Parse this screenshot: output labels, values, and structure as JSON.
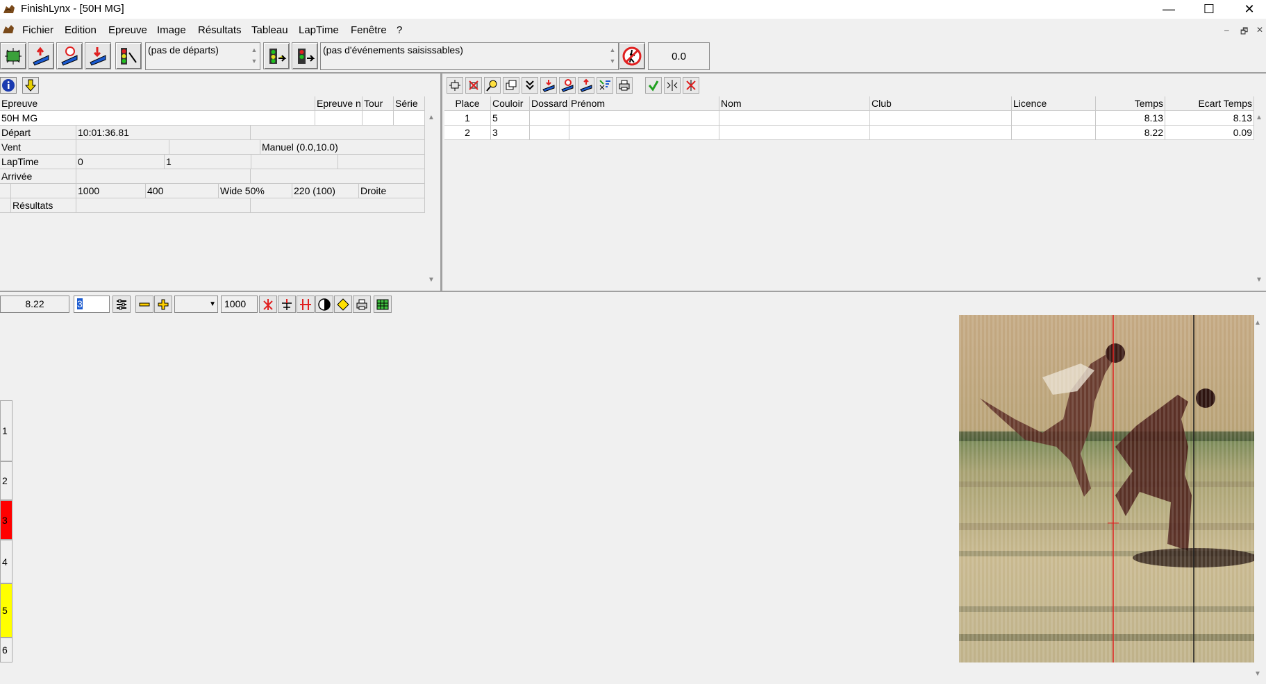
{
  "window": {
    "title": "FinishLynx - [50H MG]",
    "minimize": "—",
    "maximize": "☐",
    "close": "✕"
  },
  "menu": [
    "Fichier",
    "Edition",
    "Epreuve",
    "Image",
    "Résultats",
    "Tableau",
    "LapTime",
    "Fenêtre",
    "?"
  ],
  "mdi": {
    "minimize": "–",
    "restore": "🗗",
    "close": "✕"
  },
  "toolbar": {
    "starts_combo": "(pas de départs)",
    "events_combo": "(pas d'événements saisissables)",
    "running_time": "0.0"
  },
  "event_grid": {
    "headers": {
      "event": "Epreuve",
      "event_num": "Epreuve n",
      "round": "Tour",
      "heat": "Série"
    },
    "event_name": "50H MG",
    "rows": {
      "start": {
        "label": "Départ",
        "value": "10:01:36.81"
      },
      "wind": {
        "label": "Vent",
        "value": "Manuel (0.0,10.0)"
      },
      "laptime": {
        "label": "LapTime",
        "v1": "0",
        "v2": "1"
      },
      "arrival": {
        "label": "Arrivée"
      },
      "params": {
        "p1": "1000",
        "p2": "400",
        "p3": "Wide 50%",
        "p4": "220 (100)",
        "p5": "Droite"
      },
      "results": {
        "label": "Résultats"
      }
    }
  },
  "results_table": {
    "columns": [
      "Place",
      "Couloir",
      "Dossard",
      "Prénom",
      "Nom",
      "Club",
      "Licence",
      "Temps",
      "Ecart Temps"
    ],
    "rows": [
      {
        "place": "1",
        "lane": "5",
        "bib": "",
        "first": "",
        "last": "",
        "club": "",
        "license": "",
        "time": "8.13",
        "gap": "8.13"
      },
      {
        "place": "2",
        "lane": "3",
        "bib": "",
        "first": "",
        "last": "",
        "club": "",
        "license": "",
        "time": "8.22",
        "gap": "0.09"
      }
    ]
  },
  "image_toolbar": {
    "cursor_time": "8.22",
    "lane_input": "3",
    "density": "1000"
  },
  "lanes": [
    {
      "label": "1",
      "color": "#f0f0f0"
    },
    {
      "label": "2",
      "color": "#f0f0f0"
    },
    {
      "label": "3",
      "color": "#ff0000"
    },
    {
      "label": "4",
      "color": "#f0f0f0"
    },
    {
      "label": "5",
      "color": "#ffff00"
    },
    {
      "label": "6",
      "color": "#f0f0f0"
    }
  ],
  "colors": {
    "cursor_line": "#e02020",
    "finish_line": "#1a1a1a"
  }
}
